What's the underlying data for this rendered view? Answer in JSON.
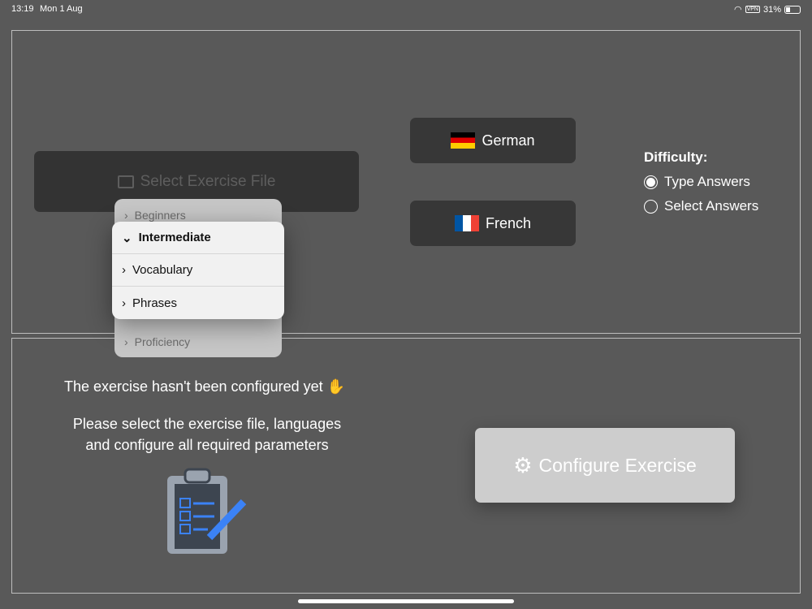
{
  "status": {
    "time": "13:19",
    "date": "Mon 1 Aug",
    "vpn": "VPN",
    "battery": "31%",
    "battery_level": 0.31
  },
  "select_file": {
    "label": "Select Exercise File"
  },
  "languages": [
    {
      "label": "German",
      "flag": "de"
    },
    {
      "label": "French",
      "flag": "fr"
    }
  ],
  "difficulty": {
    "title": "Difficulty:",
    "options": [
      {
        "label": "Type Answers",
        "selected": true
      },
      {
        "label": "Select Answers",
        "selected": false
      }
    ]
  },
  "menu": {
    "dimmed_items": [
      "Beginners",
      "Proficiency"
    ],
    "expanded": "Intermediate",
    "sub_items": [
      "Vocabulary",
      "Phrases"
    ]
  },
  "message": {
    "title": "The exercise hasn't been configured yet",
    "line1": "Please select the exercise file, languages",
    "line2": "and configure all required parameters"
  },
  "configure": {
    "label": "Configure Exercise"
  }
}
